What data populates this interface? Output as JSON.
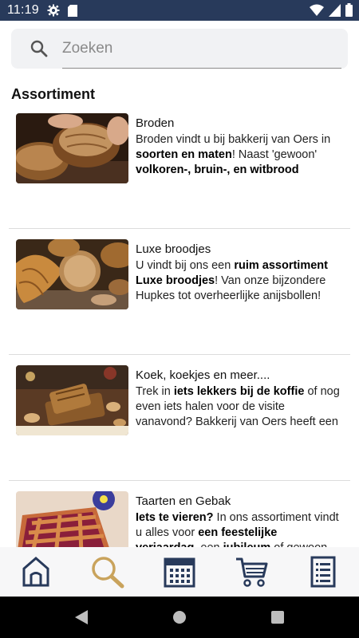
{
  "status": {
    "time": "11:19"
  },
  "search": {
    "placeholder": "Zoeken"
  },
  "section_title": "Assortiment",
  "items": [
    {
      "title": "Broden",
      "desc_parts": [
        {
          "t": "Broden vindt u bij bakkerij van Oers in ",
          "b": false
        },
        {
          "t": "soorten en maten",
          "b": true
        },
        {
          "t": "! Naast 'gewoon' ",
          "b": false
        },
        {
          "t": "volkoren-, bruin-, en witbrood",
          "b": true
        }
      ]
    },
    {
      "title": "Luxe broodjes",
      "desc_parts": [
        {
          "t": "U vindt bij ons een ",
          "b": false
        },
        {
          "t": "ruim assortiment Luxe broodjes",
          "b": true
        },
        {
          "t": "! Van onze bijzondere Hupkes tot overheerlijke anijsbollen!",
          "b": false
        }
      ]
    },
    {
      "title": "Koek, koekjes en meer....",
      "desc_parts": [
        {
          "t": "Trek in ",
          "b": false
        },
        {
          "t": "iets lekkers bij de koffie",
          "b": true
        },
        {
          "t": " of nog even iets halen voor de visite vanavond? Bakkerij van Oers heeft een",
          "b": false
        }
      ]
    },
    {
      "title": "Taarten en Gebak",
      "desc_parts": [
        {
          "t": "Iets te vieren?",
          "b": true
        },
        {
          "t": " In ons assortiment vindt u alles voor ",
          "b": false
        },
        {
          "t": "een feestelijke verjaardag",
          "b": true
        },
        {
          "t": ", een ",
          "b": false
        },
        {
          "t": "jubileum",
          "b": true
        },
        {
          "t": " of gewoon",
          "b": false
        }
      ]
    }
  ],
  "nav": {
    "items": [
      "home-icon",
      "search-icon",
      "calendar-icon",
      "cart-icon",
      "list-icon"
    ],
    "active": "search-icon",
    "accent": "#c9a35c",
    "primary": "#283a5b"
  }
}
